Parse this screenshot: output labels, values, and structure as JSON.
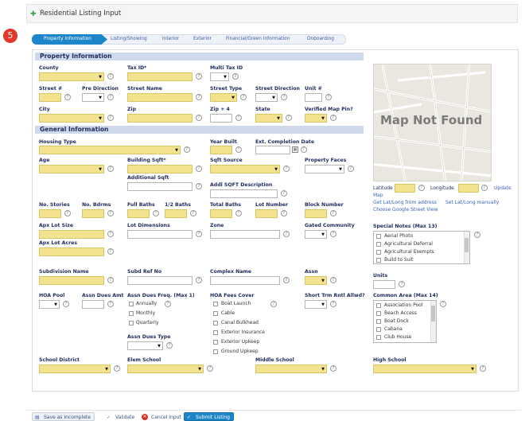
{
  "header": {
    "title": "Residential Listing Input",
    "step_badge": "5"
  },
  "tabs": [
    "Property Information",
    "Listing/Showing",
    "Interior",
    "Exterior",
    "Financial/Green Information",
    "Onboarding"
  ],
  "active_tab": 0,
  "sections": {
    "property": "Property Information",
    "general": "General Information"
  },
  "labels": {
    "county": "County",
    "tax_id": "Tax ID*",
    "multi_tax_id": "Multi Tax ID",
    "street_no": "Street #",
    "pre_direction": "Pre Direction",
    "street_name": "Street Name",
    "street_type": "Street Type",
    "street_direction": "Street Direction",
    "unit": "Unit #",
    "city": "City",
    "zip": "Zip",
    "zip4": "Zip + 4",
    "state": "State",
    "verified_map_pin": "Verified Map Pin?",
    "housing_type": "Housing Type",
    "year_built": "Year Built",
    "ext_completion_date": "Ext. Completion Date",
    "age": "Age",
    "building_sqft": "Building Sqft*",
    "sqft_source": "Sqft Source",
    "property_faces": "Property Faces",
    "additional_sqft": "Additional Sqft",
    "addl_sqft_description": "Addl SQFT Description",
    "no_stories": "No. Stories",
    "no_bdrms": "No. Bdrms",
    "full_baths": "Full Baths",
    "half_baths": "1/2 Baths",
    "total_baths": "Total Baths",
    "lot_number": "Lot Number",
    "block_number": "Block Number",
    "apx_lot_size": "Apx Lot Size",
    "lot_dimensions": "Lot Dimensions",
    "zone": "Zone",
    "gated_community": "Gated Community",
    "apx_lot_acres": "Apx Lot Acres",
    "subdivision_name": "Subdivision Name",
    "subd_ref_no": "Subd Ref No",
    "complex_name": "Complex Name",
    "assn": "Assn",
    "hoa_pool": "HOA Pool",
    "assn_dues_amt": "Assn Dues Amt",
    "assn_dues_freq": "Assn Dues Freq. (Max 1)",
    "hoa_fees_cover": "HOA Fees Cover",
    "short_trm_rntl": "Short Trm Rntl Allwd?",
    "common_area": "Common Area (Max 14)",
    "assn_dues_type": "Assn Dues Type",
    "school_district": "School District",
    "elem_school": "Elem School",
    "middle_school": "Middle School",
    "high_school": "High School",
    "special_notes": "Special Notes (Max 13)",
    "units": "Units",
    "latitude": "Latitude",
    "longitude": "Longitude"
  },
  "map": {
    "not_found": "Map Not Found",
    "update": "Update",
    "map_link": "Map",
    "get_latlong": "Get Lat/Long from address",
    "set_latlong": "Set Lat/Long manually",
    "street_view": "Choose Google Street View"
  },
  "dues_freq_options": [
    "Annually",
    "Monthly",
    "Quarterly"
  ],
  "hoa_fees_cover_options": [
    "Boat Launch",
    "Cable",
    "Canal Bulkhead",
    "Exterior Insurance",
    "Exterior Upkeep",
    "Ground Upkeep"
  ],
  "special_notes_options": [
    "Aerial Photo",
    "Agricultural Deferral",
    "Agricultural Exempts",
    "Build to Suit"
  ],
  "common_area_options": [
    "Association Pool",
    "Beach Access",
    "Boat Dock",
    "Cabana",
    "Club House"
  ],
  "footer_buttons": [
    "Save as Incomplete",
    "Validate",
    "Cancel Input",
    "Submit Listing"
  ],
  "colors": {
    "required": "#f3e38f",
    "section": "#cfd9ec",
    "active_tab": "#1d86c8",
    "submit": "#1d86c8"
  }
}
